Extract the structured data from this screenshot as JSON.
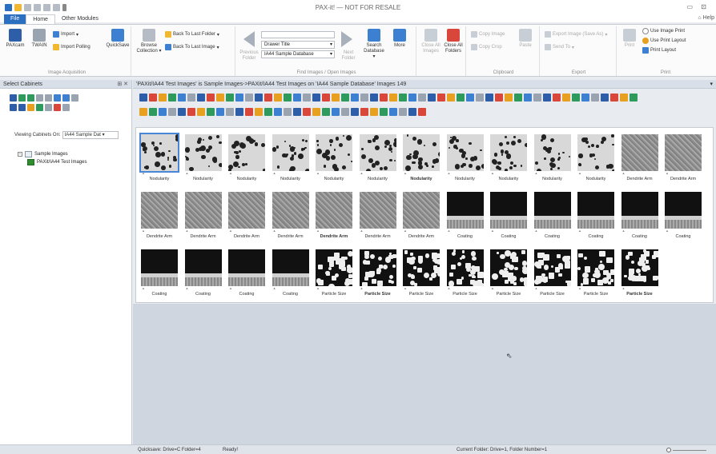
{
  "window": {
    "title": "PAX-it! — NOT FOR RESALE",
    "help": "Help"
  },
  "tabs": [
    {
      "label": "File"
    },
    {
      "label": "Home"
    },
    {
      "label": "Other Modules"
    }
  ],
  "ribbon": {
    "acquisition": {
      "group_label": "Image Acquisition",
      "paxcam": "PAXcam",
      "twain": "TWAIN",
      "quicksave": "QuickSave",
      "import": "Import",
      "import_polling": "Import Polling"
    },
    "browse": {
      "browse_collection": "Browse Collection",
      "back_folder": "Back To Last Folder",
      "back_image": "Back To Last Image"
    },
    "find": {
      "group_label": "Find Images / Open Images",
      "previous_folder": "Previous Folder",
      "next_folder": "Next Folder",
      "drawer": "Drawer Title",
      "database": "IA44 Sample Database",
      "search_database": "Search Database",
      "more": "More"
    },
    "close": {
      "close_all_images": "Close All Images",
      "close_all_folders": "Close All Folders"
    },
    "clipboard": {
      "group_label": "Clipboard",
      "copy_image": "Copy Image",
      "copy_crop": "Copy Crop",
      "paste": "Paste"
    },
    "export": {
      "group_label": "Export",
      "export_image": "Export Image (Save As)",
      "send_to": "Send To"
    },
    "print": {
      "group_label": "Print",
      "print": "Print",
      "use_image_print": "Use Image Print",
      "use_print_layout": "Use Print Layout",
      "print_layout": "Print Layout"
    }
  },
  "left_pane": {
    "title": "Select Cabinets",
    "viewing_label": "Viewing Cabinets On:",
    "viewing_value": "IA44 Sample Dat",
    "tree": {
      "root": "Sample Images",
      "child": "PAXit/IA44 Test Images"
    }
  },
  "breadcrumb": "'PAXit/IA44 Test Images' is Sample Images->PAXit/IA44 Test Images on 'IA44 Sample Database' Images 149",
  "thumbnails": [
    {
      "label": "Nodularity",
      "kind": "nod"
    },
    {
      "label": "Nodularity",
      "kind": "nod"
    },
    {
      "label": "Nodularity",
      "kind": "nod"
    },
    {
      "label": "Nodularity",
      "kind": "nod"
    },
    {
      "label": "Nodularity",
      "kind": "nod"
    },
    {
      "label": "Nodularity",
      "kind": "nod"
    },
    {
      "label": "Nodularity",
      "kind": "nod"
    },
    {
      "label": "Nodularity",
      "kind": "nod"
    },
    {
      "label": "Nodularity",
      "kind": "nod"
    },
    {
      "label": "Nodularity",
      "kind": "nod"
    },
    {
      "label": "Nodularity",
      "kind": "nod"
    },
    {
      "label": "Dendrite Arm",
      "kind": "den"
    },
    {
      "label": "Dendrite Arm",
      "kind": "den"
    },
    {
      "label": "Dendrite Arm",
      "kind": "den"
    },
    {
      "label": "Dendrite Arm",
      "kind": "den"
    },
    {
      "label": "Dendrite Arm",
      "kind": "den"
    },
    {
      "label": "Dendrite Arm",
      "kind": "den"
    },
    {
      "label": "Dendrite Arm",
      "kind": "den"
    },
    {
      "label": "Dendrite Arm",
      "kind": "den"
    },
    {
      "label": "Dendrite Arm",
      "kind": "den"
    },
    {
      "label": "Coating",
      "kind": "coat"
    },
    {
      "label": "Coating",
      "kind": "coat"
    },
    {
      "label": "Coating",
      "kind": "coat"
    },
    {
      "label": "Coating",
      "kind": "coat"
    },
    {
      "label": "Coating",
      "kind": "coat"
    },
    {
      "label": "Coating",
      "kind": "coat"
    },
    {
      "label": "Coating",
      "kind": "coat"
    },
    {
      "label": "Coating",
      "kind": "coat"
    },
    {
      "label": "Coating",
      "kind": "coat"
    },
    {
      "label": "Coating",
      "kind": "coat"
    },
    {
      "label": "Particle Size",
      "kind": "part"
    },
    {
      "label": "Particle Size",
      "kind": "part"
    },
    {
      "label": "Particle Size",
      "kind": "part"
    },
    {
      "label": "Particle Size",
      "kind": "part"
    },
    {
      "label": "Particle Size",
      "kind": "part"
    },
    {
      "label": "Particle Size",
      "kind": "part"
    },
    {
      "label": "Particle Size",
      "kind": "part"
    },
    {
      "label": "Particle Size",
      "kind": "part"
    }
  ],
  "status": {
    "quicksave": "Quicksave: Drive=C Folder=4",
    "ready": "Ready!",
    "current": "Current Folder: Drive=1, Folder Number=1"
  },
  "colors": {
    "accent": "#2a6fc0",
    "selection": "#4a86d6"
  }
}
